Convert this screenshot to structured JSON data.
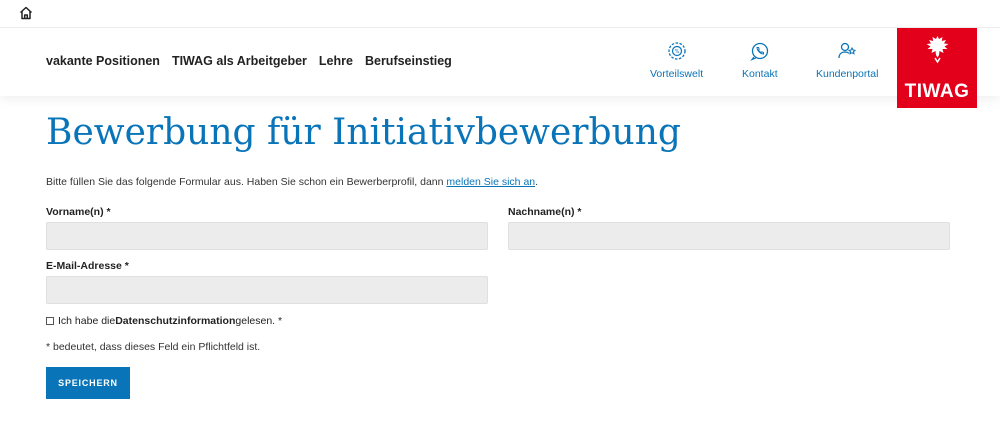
{
  "header": {
    "nav_links": [
      "vakante Positionen",
      "TIWAG als Arbeitgeber",
      "Lehre",
      "Berufseinstieg"
    ],
    "quick_links": [
      {
        "label": "Vorteilswelt",
        "icon": "benefits-icon"
      },
      {
        "label": "Kontakt",
        "icon": "contact-icon"
      },
      {
        "label": "Kundenportal",
        "icon": "customer-portal-icon"
      }
    ],
    "logo_text": "TIWAG",
    "brand_color": "#e3001b",
    "accent_color": "#0a74b8"
  },
  "page": {
    "title": "Bewerbung für Initiativbewerbung",
    "intro_text": "Bitte füllen Sie das folgende Formular aus. Haben Sie schon ein Bewerberprofil, dann ",
    "intro_link": "melden Sie sich an",
    "intro_end": "."
  },
  "form": {
    "first_name_label": "Vorname(n) *",
    "first_name_value": "",
    "last_name_label": "Nachname(n) *",
    "last_name_value": "",
    "email_label": "E-Mail-Adresse *",
    "email_value": "",
    "consent_prefix": "Ich habe die ",
    "consent_bold": "Datenschutzinformation",
    "consent_suffix": " gelesen. *",
    "required_note": "* bedeutet, dass dieses Feld ein Pflichtfeld ist.",
    "save_label": "SPEICHERN"
  }
}
